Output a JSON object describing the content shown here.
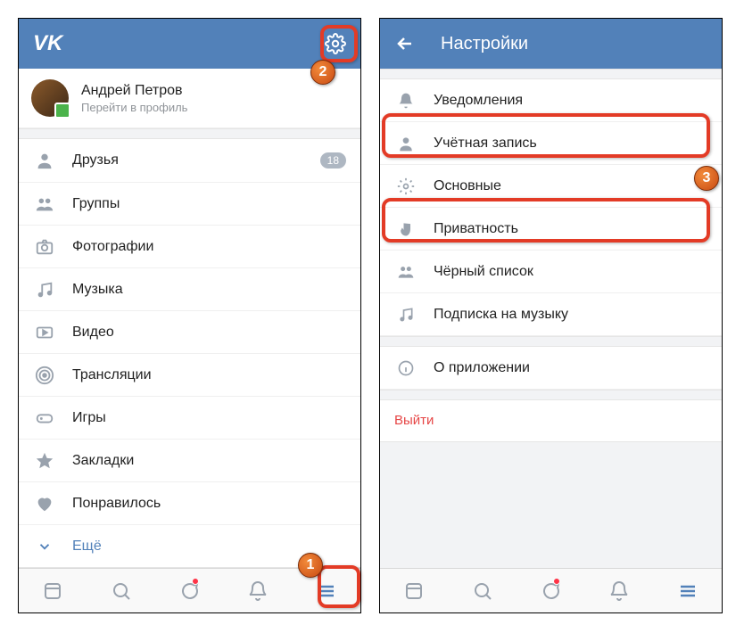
{
  "left": {
    "logo": "VK",
    "profile": {
      "name": "Андрей Петров",
      "subtitle": "Перейти в профиль"
    },
    "menu": [
      {
        "label": "Друзья",
        "badge": "18"
      },
      {
        "label": "Группы"
      },
      {
        "label": "Фотографии"
      },
      {
        "label": "Музыка"
      },
      {
        "label": "Видео"
      },
      {
        "label": "Трансляции"
      },
      {
        "label": "Игры"
      },
      {
        "label": "Закладки"
      },
      {
        "label": "Понравилось"
      }
    ],
    "more": "Ещё"
  },
  "right": {
    "title": "Настройки",
    "items": [
      {
        "label": "Уведомления"
      },
      {
        "label": "Учётная запись"
      },
      {
        "label": "Основные"
      },
      {
        "label": "Приватность"
      },
      {
        "label": "Чёрный список"
      },
      {
        "label": "Подписка на музыку"
      }
    ],
    "about": "О приложении",
    "logout": "Выйти"
  },
  "markers": {
    "one": "1",
    "two": "2",
    "three": "3"
  }
}
